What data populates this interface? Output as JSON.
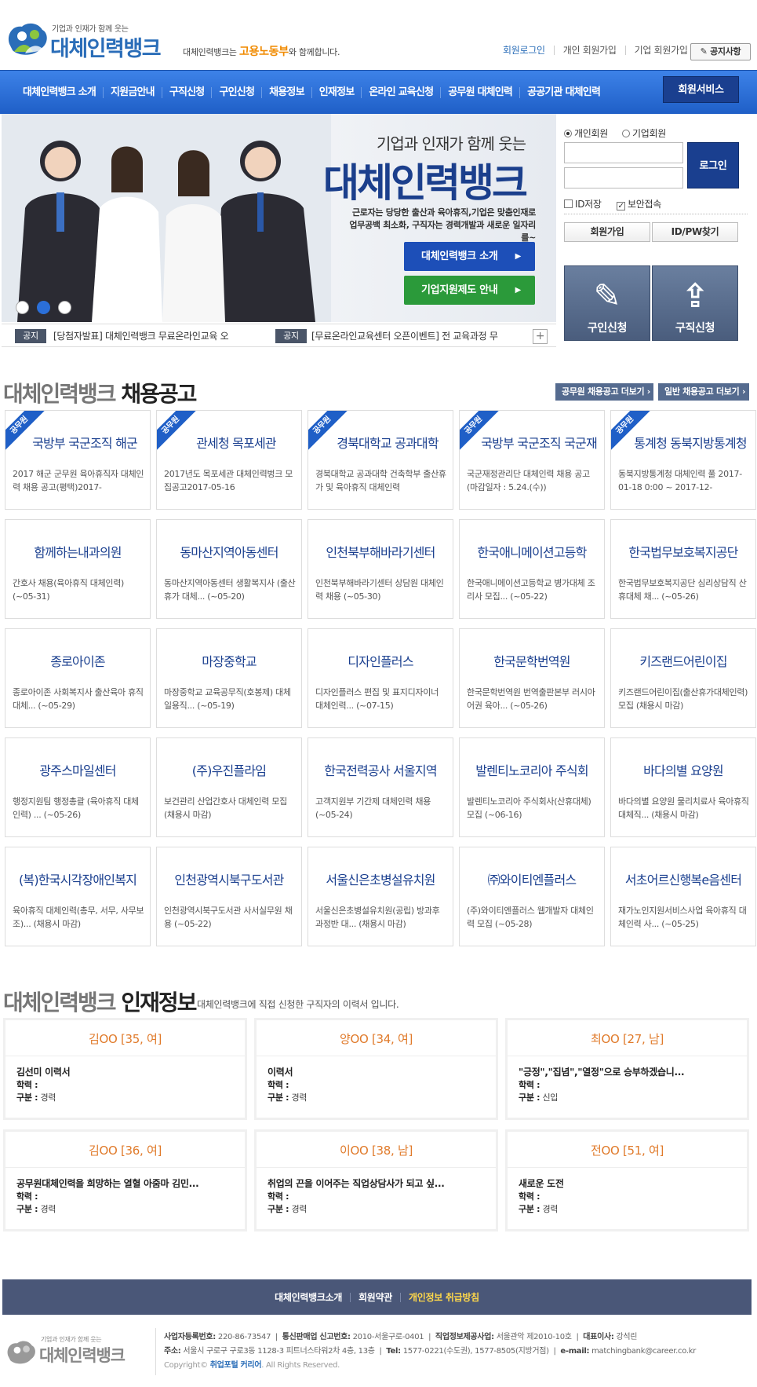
{
  "header": {
    "logo_sub": "기업과 인재가 함께 웃는",
    "logo_main": "대체인력뱅크",
    "tagline_pre": "대체인력뱅크는 ",
    "tagline_brand": "고용노동부",
    "tagline_post": "와 함께합니다.",
    "links": [
      "회원로그인",
      "개인 회원가입",
      "기업 회원가입"
    ],
    "notice_label": "공지사항"
  },
  "nav": {
    "items": [
      "대체인력뱅크 소개",
      "지원금안내",
      "구직신청",
      "구인신청",
      "채용정보",
      "인재정보",
      "온라인 교육신청",
      "공무원 대체인력",
      "공공기관 대체인력"
    ],
    "member_service": "회원서비스"
  },
  "hero": {
    "subtitle": "기업과 인재가 함께 웃는",
    "title": "대체인력뱅크",
    "desc1": "근로자는 당당한 출산과 육아휴직,기업은 맞춤인재로",
    "desc2": "업무공백 최소화, 구직자는 경력개발과 새로운 일자리를~",
    "btn1": "대체인력뱅크 소개",
    "btn2": "기업지원제도 안내",
    "slide_active": 2
  },
  "notices": [
    {
      "tag": "공지",
      "text": "[당첨자발표] 대체인력뱅크 무료온라인교육 오"
    },
    {
      "tag": "공지",
      "text": "[무료온라인교육센터 오픈이벤트] 전 교육과정 무"
    }
  ],
  "login": {
    "radio_personal": "개인회원",
    "radio_company": "기업회원",
    "login_btn": "로그인",
    "save_id": "ID저장",
    "secure": "보안접속",
    "join": "회원가입",
    "find": "ID/PW찾기",
    "apply_seek": "구인신청",
    "apply_job": "구직신청"
  },
  "jobs_section": {
    "title_pre": "대체인력뱅크 ",
    "title_main": "채용공고",
    "btn_public": "공무원 채용공고 더보기 ›",
    "btn_general": "일반 채용공고 더보기 ›",
    "ribbon": "공무원",
    "cards": [
      {
        "title": "국방부 국군조직 해군",
        "desc": "2017 해군 군무원 육아휴직자 대체인력 채용 공고(평택)2017-",
        "pub": true
      },
      {
        "title": "관세청 목포세관",
        "desc": "2017년도 목포세관 대체인력벙크 모집공고2017-05-16",
        "pub": true
      },
      {
        "title": "경북대학교 공과대학",
        "desc": "경북대학교 공과대학 건축학부 출산휴가 및 육아휴직 대체인력",
        "pub": true
      },
      {
        "title": "국방부 국군조직 국군재",
        "desc": "국군재정관리단 대체인력 채용 공고(마감일자 : 5.24.(수))",
        "pub": true
      },
      {
        "title": "통계청 동북지방통계청",
        "desc": "동북지방통계청 대체인력 풀 2017-01-18 0:00 ~ 2017-12-",
        "pub": true
      },
      {
        "title": "함께하는내과의원",
        "desc": "간호사 채용(육아휴직 대체인력) (~05-31)",
        "pub": false
      },
      {
        "title": "동마산지역아동센터",
        "desc": "동마산지역아동센터 생활복지사 (출산휴가 대체... (~05-20)",
        "pub": false
      },
      {
        "title": "인천북부해바라기센터",
        "desc": "인천북부해바라기센터 상담원 대체인력 채용 (~05-30)",
        "pub": false
      },
      {
        "title": "한국애니메이션고등학",
        "desc": "한국애니메이션고등학교 병가대체 조리사 모집... (~05-22)",
        "pub": false
      },
      {
        "title": "한국법무보호복지공단",
        "desc": "한국법무보호복지공단 심리상담직 산휴대체 채... (~05-26)",
        "pub": false
      },
      {
        "title": "종로아이존",
        "desc": "종로아이존 사회복지사 출산육아 휴직 대체... (~05-29)",
        "pub": false
      },
      {
        "title": "마장중학교",
        "desc": "마장중학교 교육공무직(호봉제) 대체 일용직... (~05-19)",
        "pub": false
      },
      {
        "title": "디자인플러스",
        "desc": "디자인플러스 편집 및 표지디자이너 대체인력... (~07-15)",
        "pub": false
      },
      {
        "title": "한국문학번역원",
        "desc": "한국문학번역원 번역출판본부 러시아어권 육아... (~05-26)",
        "pub": false
      },
      {
        "title": "키즈랜드어린이집",
        "desc": "키즈랜드어린이집(출산휴가대체인력) 모집 (채용시 마감)",
        "pub": false
      },
      {
        "title": "광주스마일센터",
        "desc": "행정지원팀 행정총괄 (육아휴직 대체인력) ... (~05-26)",
        "pub": false
      },
      {
        "title": "(주)우진플라임",
        "desc": "보건관리 산업간호사 대체인력 모집 (채용시 마감)",
        "pub": false
      },
      {
        "title": "한국전력공사 서울지역",
        "desc": "고객지원부 기간제 대체인력 채용 (~05-24)",
        "pub": false
      },
      {
        "title": "발렌티노코리아 주식회",
        "desc": "발렌티노코리아 주식회사(산휴대체) 모집 (~06-16)",
        "pub": false
      },
      {
        "title": "바다의별 요양원",
        "desc": "바다의별 요양원 물리치료사 육아휴직 대체직... (채용시 마감)",
        "pub": false
      },
      {
        "title": "(복)한국시각장애인복지",
        "desc": "육아휴직 대체인력(총무, 서무, 사무보조)... (채용시 마감)",
        "pub": false
      },
      {
        "title": "인천광역시북구도서관",
        "desc": "인천광역시북구도서관 사서실무원 채용 (~05-22)",
        "pub": false
      },
      {
        "title": "서울신은초병설유치원",
        "desc": "서울신은초병설유치원(공립) 방과후과정반 대... (채용시 마감)",
        "pub": false
      },
      {
        "title": "㈜와이티엔플러스",
        "desc": "(주)와이티엔플러스 웹개발자 대체인력 모집 (~05-28)",
        "pub": false
      },
      {
        "title": "서초어르신행복e음센터",
        "desc": "재가노인지원서비스사업 육아휴직 대체인력 사... (~05-25)",
        "pub": false
      }
    ]
  },
  "talent_section": {
    "title_pre": "대체인력뱅크 ",
    "title_main": "인재정보",
    "subtitle": "대체인력뱅크에 직접 신청한 구직자의 이력서 입니다.",
    "label_edu": "학력 :",
    "label_type": "구분 :",
    "cards": [
      {
        "name": "김OO [35, 여]",
        "title": "김선미 이력서",
        "type": "경력"
      },
      {
        "name": "양OO [34, 여]",
        "title": "이력서",
        "type": "경력"
      },
      {
        "name": "최OO [27, 남]",
        "title": "\"긍정\",\"집념\",\"열정\"으로 승부하겠습니...",
        "type": "신입"
      },
      {
        "name": "김OO [36, 여]",
        "title": "공무원대체인력을 희망하는 열혈 아줌마 김민...",
        "type": "경력"
      },
      {
        "name": "이OO [38, 남]",
        "title": "취업의 끈을 이어주는 직업상담사가 되고 싶...",
        "type": "경력"
      },
      {
        "name": "전OO [51, 여]",
        "title": "새로운 도전",
        "type": "경력"
      }
    ]
  },
  "footer": {
    "links": [
      "대체인력뱅크소개",
      "회원약관",
      "개인정보 취급방침"
    ],
    "biz_no_label": "사업자등록번호:",
    "biz_no": "220-86-73547",
    "mail_order_label": "통신판매업 신고번호:",
    "mail_order": "2010-서울구로-0401",
    "job_info_label": "직업정보제공사업:",
    "job_info": "서울관악 제2010-10호",
    "ceo_label": "대표이사:",
    "ceo": "강석린",
    "addr_label": "주소:",
    "addr": "서울시 구로구 구로3동 1128-3 피트너스타워2차 4층, 13층",
    "tel_label": "Tel:",
    "tel": "1577-0221(수도권), 1577-8505(지방거점)",
    "email_label": "e-mail:",
    "email": "matchingbank@career.co.kr",
    "copy_pre": "Copyright© ",
    "copy_brand": "취업포털 커리어",
    "copy_post": ". All Rights Reserved."
  }
}
